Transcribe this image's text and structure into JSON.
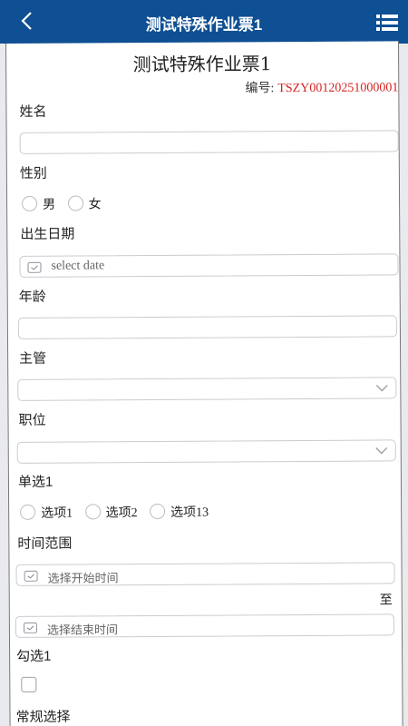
{
  "header": {
    "title": "测试特殊作业票1"
  },
  "form": {
    "title": "测试特殊作业票1",
    "code_label": "编号:",
    "code_value": "TSZY00120251000001",
    "fields": {
      "name_label": "姓名",
      "gender_label": "性别",
      "gender_options": [
        "男",
        "女"
      ],
      "birth_label": "出生日期",
      "birth_placeholder": "select date",
      "age_label": "年龄",
      "supervisor_label": "主管",
      "position_label": "职位",
      "single_label": "单选1",
      "single_options": [
        "选项1",
        "选项2",
        "选项13"
      ],
      "time_range_label": "时间范围",
      "start_placeholder": "选择开始时间",
      "to_label": "至",
      "end_placeholder": "选择结束时间",
      "check_label": "勾选1",
      "normal_select_label": "常规选择"
    }
  },
  "colors": {
    "header_bg": "#0f4f93",
    "code_value": "#d61f1f"
  },
  "icons": [
    "back-arrow-icon",
    "menu-list-icon",
    "calendar-icon",
    "chevron-down-icon"
  ]
}
